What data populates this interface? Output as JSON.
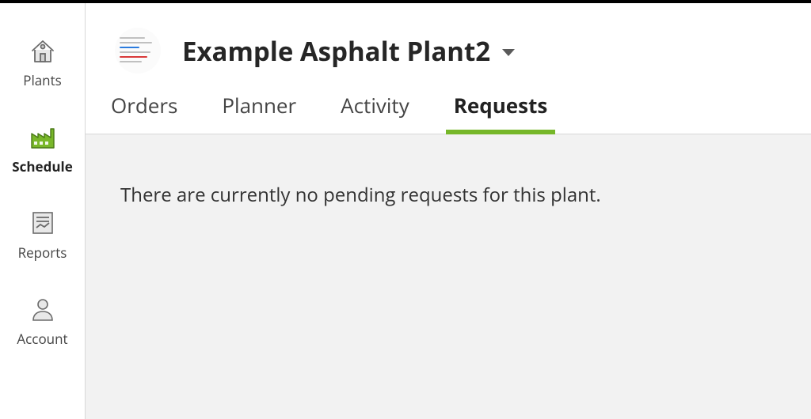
{
  "sidebar": {
    "plants": "Plants",
    "schedule": "Schedule",
    "reports": "Reports",
    "account": "Account"
  },
  "header": {
    "plant_name": "Example Asphalt Plant2"
  },
  "tabs": {
    "orders": "Orders",
    "planner": "Planner",
    "activity": "Activity",
    "requests": "Requests"
  },
  "content": {
    "empty_requests": "There are currently no pending requests for this plant."
  }
}
